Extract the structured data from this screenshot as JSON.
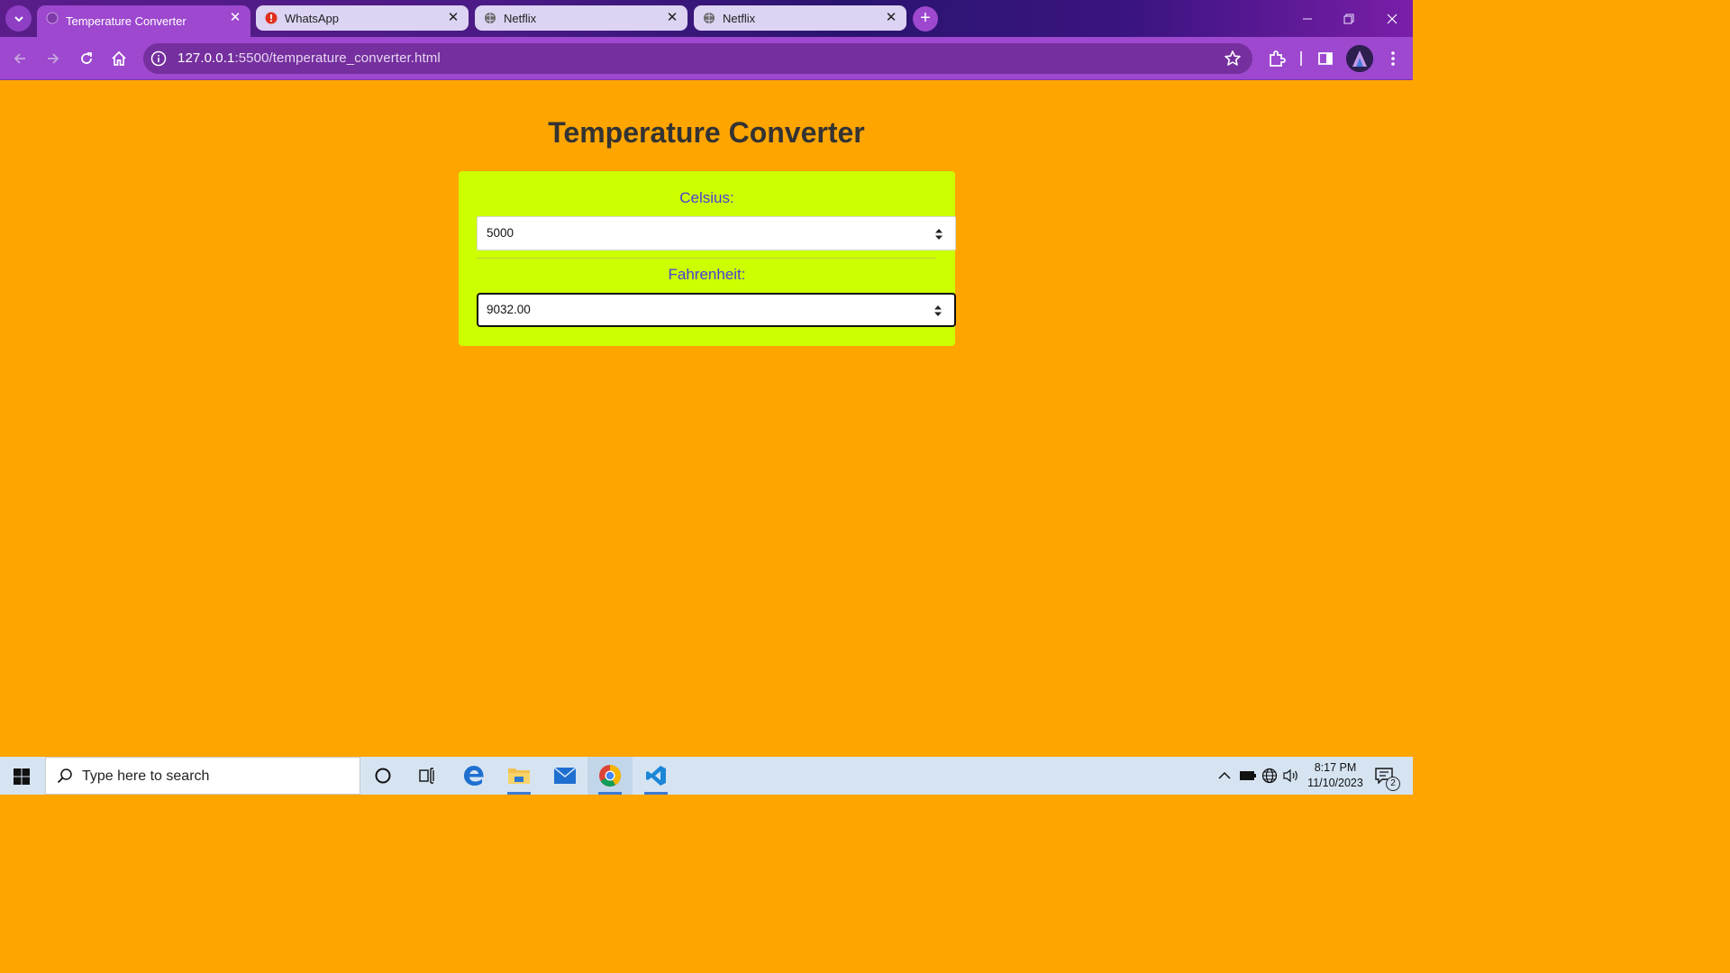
{
  "browser": {
    "tabs": [
      {
        "title": "Temperature Converter",
        "active": true
      },
      {
        "title": "WhatsApp",
        "active": false
      },
      {
        "title": "Netflix",
        "active": false
      },
      {
        "title": "Netflix",
        "active": false
      }
    ],
    "tab_close_glyph": "✕",
    "new_tab_glyph": "+",
    "url_host": "127.0.0.1",
    "url_path": ":5500/temperature_converter.html",
    "window_buttons": {
      "minimize": "—",
      "restore": "❐",
      "close": "✕"
    }
  },
  "page": {
    "title": "Temperature Converter",
    "celsius": {
      "label": "Celsius:",
      "value": "5000"
    },
    "fahrenheit": {
      "label": "Fahrenheit:",
      "value": "9032.00"
    },
    "colors": {
      "background": "#ffa500",
      "card": "#ccff00",
      "label": "#4a3fd8",
      "title": "#333333"
    }
  },
  "taskbar": {
    "search_placeholder": "Type here to search",
    "time": "8:17 PM",
    "date": "11/10/2023",
    "notification_count": "2",
    "apps": [
      "cortana-icon",
      "task-view-icon",
      "edge-icon",
      "file-explorer-icon",
      "mail-icon",
      "chrome-icon",
      "vscode-icon"
    ]
  },
  "colors": {
    "browser_accent": "#9d48cf",
    "taskbar": "#d6e4f2"
  }
}
